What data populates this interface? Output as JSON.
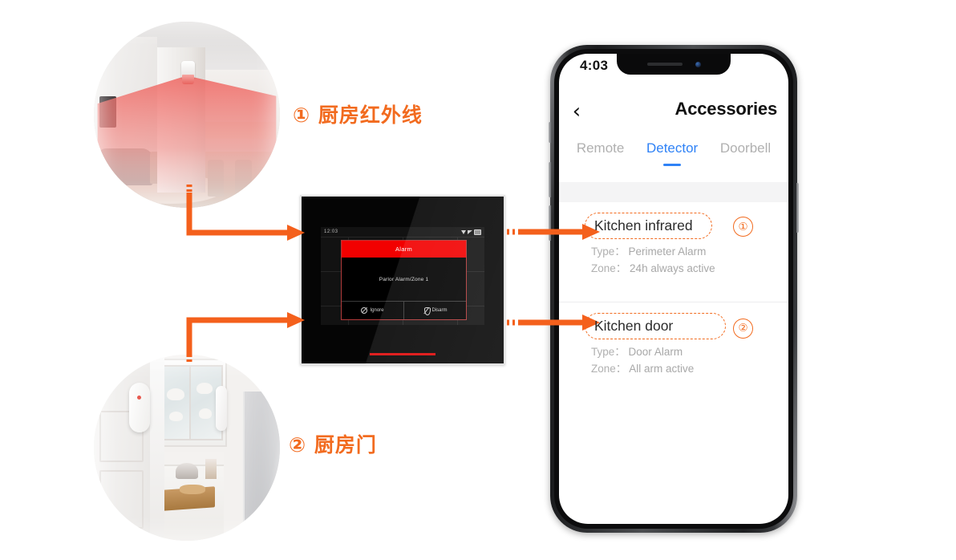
{
  "annotations": {
    "label_1": "① 厨房红外线",
    "label_2": "② 厨房门",
    "marker_1": "①",
    "marker_2": "②"
  },
  "alarm_panel": {
    "status_bar": {
      "clock": "12:03"
    },
    "dialog": {
      "title": "Alarm",
      "message": "Parlor Alarm/Zone 1",
      "ignore_label": "Ignore",
      "disarm_label": "Disarm"
    }
  },
  "phone": {
    "status_bar": {
      "time": "4:03"
    },
    "nav": {
      "back_icon": "‹",
      "title": "Accessories"
    },
    "tabs": [
      {
        "label": "Remote",
        "active": false
      },
      {
        "label": "Detector",
        "active": true
      },
      {
        "label": "Doorbell",
        "active": false
      }
    ],
    "detectors": [
      {
        "name": "Kitchen infrared",
        "type_label": "Type：",
        "type_value": "Perimeter Alarm",
        "zone_label": "Zone：",
        "zone_value": "24h always active",
        "marker": "①"
      },
      {
        "name": "Kitchen door",
        "type_label": "Type：",
        "type_value": "Door Alarm",
        "zone_label": "Zone：",
        "zone_value": "All arm active",
        "marker": "②"
      }
    ]
  },
  "colors": {
    "accent_orange": "#f26b1f",
    "tab_blue": "#2f82f6",
    "alarm_red": "#f20000"
  }
}
